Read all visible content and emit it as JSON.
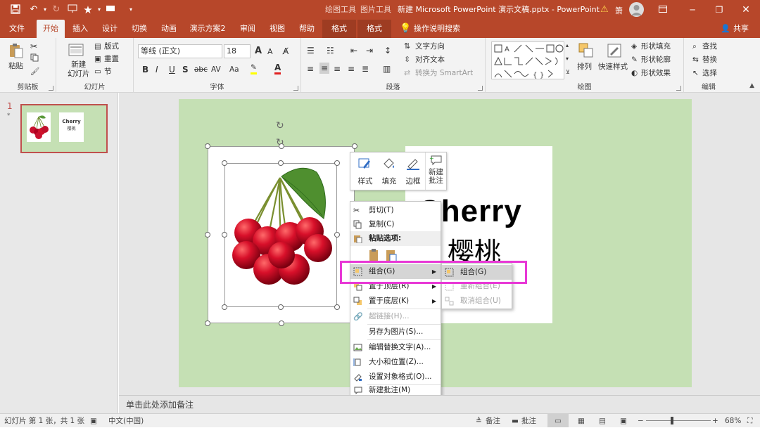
{
  "titlebar": {
    "contextual_tabs": [
      "绘图工具",
      "图片工具"
    ],
    "title": "新建 Microsoft PowerPoint 演示文稿.pptx  -  PowerPoint",
    "warning": "⚠",
    "user": "箫"
  },
  "tabs": [
    "文件",
    "开始",
    "插入",
    "设计",
    "切换",
    "动画",
    "演示方案2",
    "审阅",
    "视图",
    "帮助",
    "格式",
    "格式"
  ],
  "tell_me": "操作说明搜索",
  "share": "共享",
  "ribbon": {
    "clipboard": {
      "label": "剪贴板",
      "paste": "粘贴"
    },
    "slides": {
      "label": "幻灯片",
      "new_slide": "新建\n幻灯片",
      "layout": "版式",
      "reset": "重置",
      "section": "节"
    },
    "font": {
      "label": "字体",
      "font_name": "等线 (正文)",
      "font_size": "18",
      "bold": "B",
      "italic": "I",
      "underline": "U",
      "shadow": "S",
      "strike": "abc",
      "spacing": "AV",
      "case": "Aa",
      "grow": "A",
      "shrink": "A"
    },
    "paragraph": {
      "label": "段落",
      "text_direction": "文字方向",
      "align_text": "对齐文本",
      "smartart": "转换为 SmartArt"
    },
    "drawing": {
      "label": "绘图",
      "arrange": "排列",
      "quick_styles": "快速样式",
      "fill": "形状填充",
      "outline": "形状轮廓",
      "effects": "形状效果"
    },
    "editing": {
      "label": "编辑",
      "find": "查找",
      "replace": "替换",
      "select": "选择"
    }
  },
  "thumbnail": {
    "number": "1",
    "star": "*",
    "title": "Cherry",
    "subtitle": "樱桃"
  },
  "slide": {
    "title": "Cherry",
    "subtitle": "樱桃"
  },
  "minibar": {
    "style": "样式",
    "fill": "填充",
    "outline": "边框",
    "new_comment": "新建\n批注"
  },
  "context_menu": {
    "items": [
      {
        "label": "剪切(T)",
        "disabled": false
      },
      {
        "label": "复制(C)",
        "disabled": false
      },
      {
        "label": "粘贴选项:",
        "disabled": false
      },
      {
        "label": "组合(G)",
        "disabled": false
      },
      {
        "label": "置于顶层(R)",
        "disabled": false
      },
      {
        "label": "置于底层(K)",
        "disabled": false
      },
      {
        "label": "超链接(H)...",
        "disabled": true
      },
      {
        "label": "另存为图片(S)...",
        "disabled": false
      },
      {
        "label": "编辑替换文字(A)...",
        "disabled": false
      },
      {
        "label": "大小和位置(Z)...",
        "disabled": false
      },
      {
        "label": "设置对象格式(O)...",
        "disabled": false
      },
      {
        "label": "新建批注(M)",
        "disabled": false
      }
    ],
    "submenu": [
      {
        "label": "组合(G)",
        "disabled": false
      },
      {
        "label": "重新组合(E)",
        "disabled": true
      },
      {
        "label": "取消组合(U)",
        "disabled": true
      }
    ]
  },
  "notes_placeholder": "单击此处添加备注",
  "status": {
    "slide_info": "幻灯片 第 1 张，共 1 张",
    "language": "中文(中国)",
    "notes": "备注",
    "comments": "批注",
    "zoom": "68%"
  },
  "colors": {
    "accent": "#b7472a",
    "slide_bg": "#c5e0b4",
    "highlight_box": "#e838d6"
  }
}
